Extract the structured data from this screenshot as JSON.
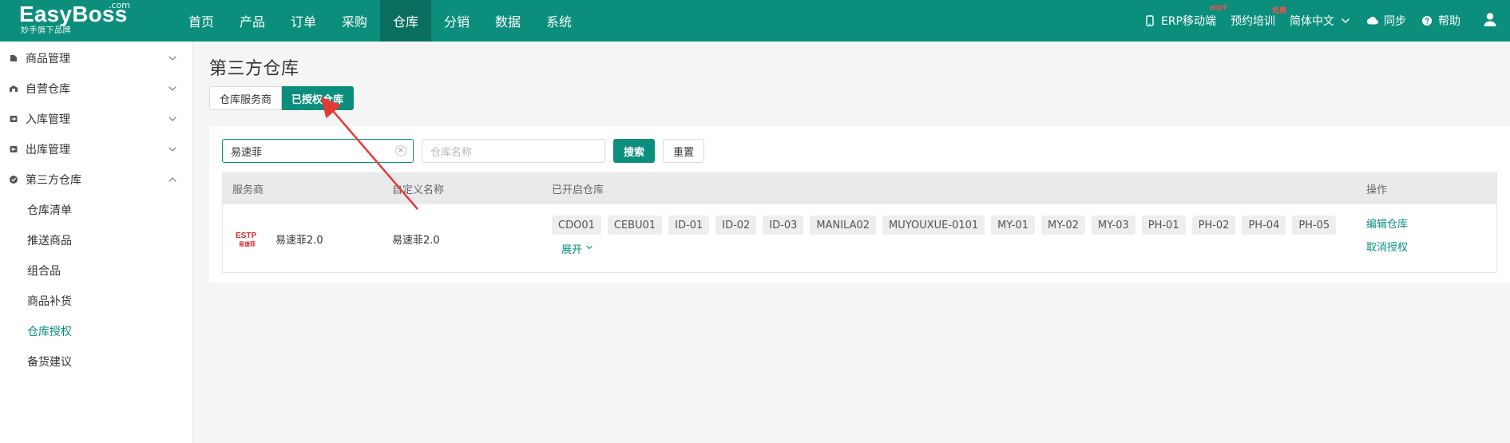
{
  "colors": {
    "brand": "#0b8f7c",
    "brand_dark": "#0a6f60",
    "annotation_arrow": "#e53935"
  },
  "topbar": {
    "logo_main": "EasyBoss",
    "logo_com": ".com",
    "logo_sub": "妙手旗下品牌",
    "nav": [
      {
        "label": "首页"
      },
      {
        "label": "产品"
      },
      {
        "label": "订单"
      },
      {
        "label": "采购"
      },
      {
        "label": "仓库",
        "active": true
      },
      {
        "label": "分销"
      },
      {
        "label": "数据"
      },
      {
        "label": "系统"
      }
    ],
    "right": {
      "erp_mobile": "ERP移动端",
      "erp_hot": "HOT",
      "training": "预约培训",
      "training_badge": "免费",
      "language": "简体中文",
      "sync": "同步",
      "help": "帮助"
    },
    "icons": {
      "mobile": "mobile-icon",
      "chevron": "chevron-down-icon",
      "cloud": "cloud-icon",
      "help": "question-circle-icon",
      "user": "user-icon"
    }
  },
  "sidebar": {
    "groups": [
      {
        "label": "商品管理",
        "icon": "product-icon",
        "expanded": false
      },
      {
        "label": "自营仓库",
        "icon": "warehouse-icon",
        "expanded": false
      },
      {
        "label": "入库管理",
        "icon": "inbound-icon",
        "expanded": false
      },
      {
        "label": "出库管理",
        "icon": "outbound-icon",
        "expanded": false
      },
      {
        "label": "第三方仓库",
        "icon": "third-party-warehouse-icon",
        "expanded": true
      }
    ],
    "sub_items": [
      {
        "label": "仓库清单"
      },
      {
        "label": "推送商品"
      },
      {
        "label": "组合品"
      },
      {
        "label": "商品补货"
      },
      {
        "label": "仓库授权",
        "active": true
      },
      {
        "label": "备货建议"
      }
    ]
  },
  "main": {
    "page_title": "第三方仓库",
    "tabs": [
      {
        "label": "仓库服务商"
      },
      {
        "label": "已授权仓库",
        "active": true
      }
    ],
    "filters": {
      "provider_value": "易速菲",
      "warehouse_name_placeholder": "仓库名称",
      "search_button": "搜索",
      "reset_button": "重置"
    },
    "table": {
      "headers": [
        "服务商",
        "自定义名称",
        "已开启仓库",
        "操作"
      ],
      "rows": [
        {
          "provider_name": "易速菲2.0",
          "provider_logo_text_top": "ESTP",
          "provider_logo_text_bottom": "易速菲",
          "custom_name": "易速菲2.0",
          "warehouses": [
            "CDO01",
            "CEBU01",
            "ID-01",
            "ID-02",
            "ID-03",
            "MANILA02",
            "MUYOUXUE-0101",
            "MY-01",
            "MY-02",
            "MY-03",
            "PH-01",
            "PH-02",
            "PH-04",
            "PH-05"
          ],
          "expand_label": "展开",
          "ops": [
            "编辑仓库",
            "取消授权"
          ]
        }
      ]
    }
  }
}
